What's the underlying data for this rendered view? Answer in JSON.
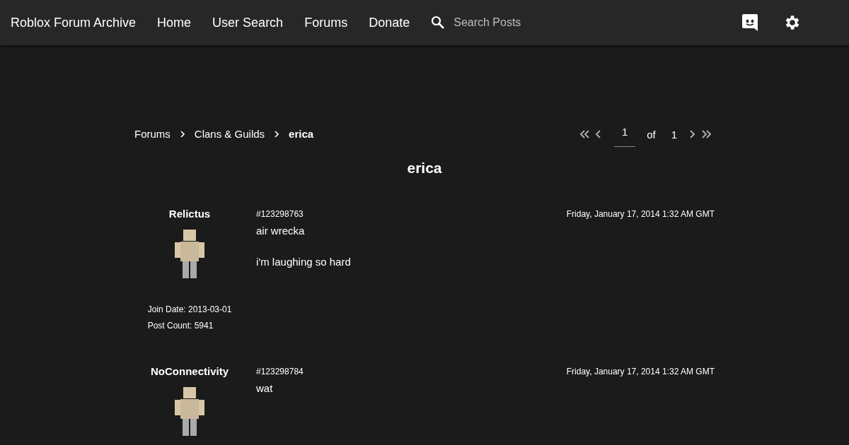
{
  "navbar": {
    "brand": "Roblox Forum Archive",
    "links": [
      "Home",
      "User Search",
      "Forums",
      "Donate"
    ],
    "search": {
      "placeholder": "Search Posts"
    }
  },
  "breadcrumb": [
    "Forums",
    "Clans & Guilds",
    "erica"
  ],
  "pagination": {
    "page": "1",
    "of_label": "of",
    "total": "1"
  },
  "thread_title": "erica",
  "posts": [
    {
      "author": "Relictus",
      "id": "#123298763",
      "date": "Friday, January 17, 2014 1:32 AM GMT",
      "body": [
        "air wrecka",
        "i'm laughing so hard"
      ],
      "join_date": "Join Date: 2013-03-01",
      "post_count": "Post Count: 5941"
    },
    {
      "author": "NoConnectivity",
      "id": "#123298784",
      "date": "Friday, January 17, 2014 1:32 AM GMT",
      "body": [
        "wat"
      ]
    }
  ]
}
